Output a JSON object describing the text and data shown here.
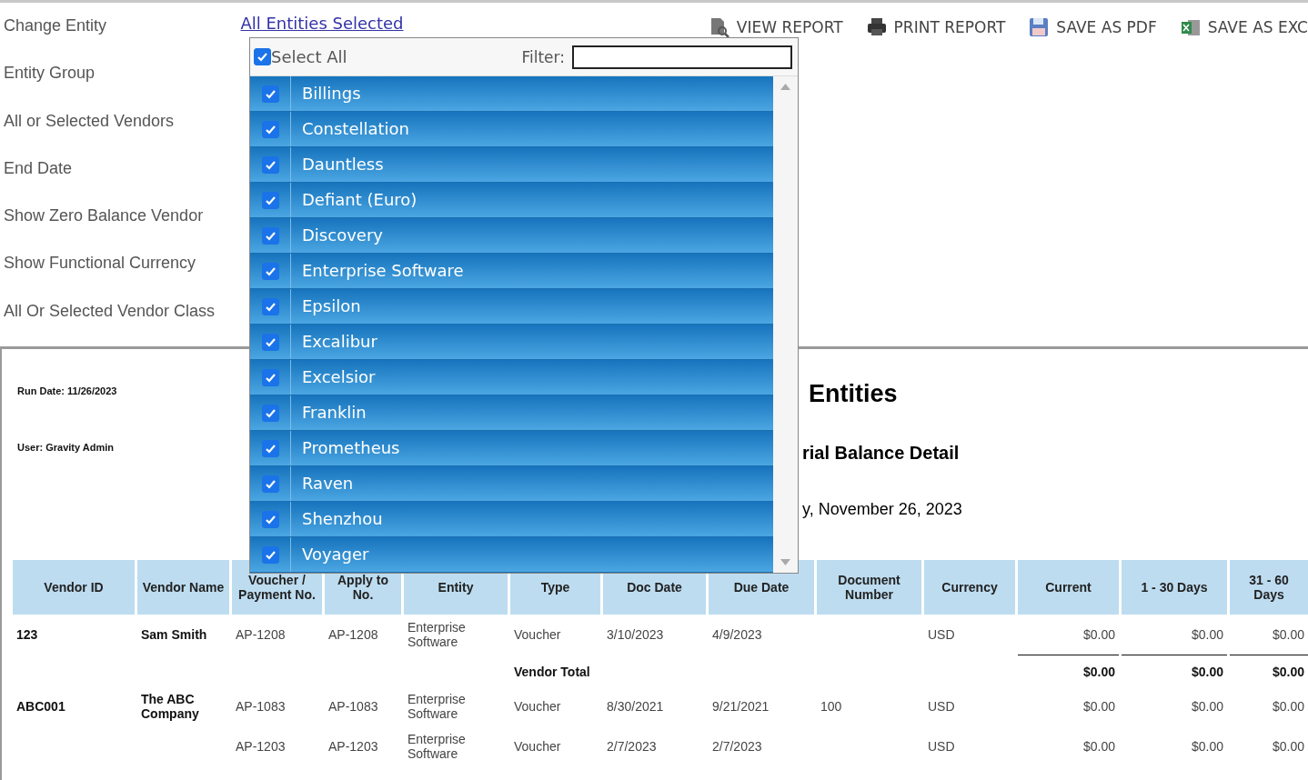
{
  "filters": {
    "labels": [
      "Change Entity",
      "Entity Group",
      "All or Selected Vendors",
      "End Date",
      "Show Zero Balance Vendor",
      "Show Functional Currency",
      "All Or Selected Vendor Class"
    ],
    "entity_link": "All Entities Selected"
  },
  "toolbar": [
    {
      "kind": "view",
      "label": "VIEW REPORT"
    },
    {
      "kind": "print",
      "label": "PRINT REPORT"
    },
    {
      "kind": "pdf",
      "label": "SAVE AS PDF"
    },
    {
      "kind": "excel",
      "label": "SAVE AS EXC"
    }
  ],
  "dropdown": {
    "select_all": {
      "label": "Select All",
      "checked": true
    },
    "filter_label": "Filter:",
    "items": [
      {
        "label": "Billings",
        "checked": true
      },
      {
        "label": "Constellation",
        "checked": true
      },
      {
        "label": "Dauntless",
        "checked": true
      },
      {
        "label": "Defiant (Euro)",
        "checked": true
      },
      {
        "label": "Discovery",
        "checked": true
      },
      {
        "label": "Enterprise Software",
        "checked": true
      },
      {
        "label": "Epsilon",
        "checked": true
      },
      {
        "label": "Excalibur",
        "checked": true
      },
      {
        "label": "Excelsior",
        "checked": true
      },
      {
        "label": "Franklin",
        "checked": true
      },
      {
        "label": "Prometheus",
        "checked": true
      },
      {
        "label": "Raven",
        "checked": true
      },
      {
        "label": "Shenzhou",
        "checked": true
      },
      {
        "label": "Voyager",
        "checked": true
      }
    ]
  },
  "report": {
    "run_date": "Run Date: 11/26/2023",
    "user": "User: Gravity Admin",
    "title": "Entities",
    "subtitle": "rial Balance Detail",
    "date": "y, November 26, 2023",
    "table": {
      "columns": [
        "Vendor ID",
        "Vendor Name",
        "Voucher / Payment No.",
        "Apply to No.",
        "Entity",
        "Type",
        "Doc Date",
        "Due Date",
        "Document Number",
        "Currency",
        "Current",
        "1 - 30 Days",
        "31 - 60 Days"
      ],
      "rows": [
        {
          "kind": "line",
          "cells": [
            "123",
            "Sam Smith",
            "AP-1208",
            "AP-1208",
            "Enterprise Software",
            "Voucher",
            "3/10/2023",
            "4/9/2023",
            null,
            "USD",
            "$0.00",
            "$0.00",
            "$0.00"
          ]
        },
        {
          "kind": "total",
          "cells": [
            null,
            null,
            null,
            null,
            null,
            "Vendor Total",
            null,
            null,
            null,
            null,
            "$0.00",
            "$0.00",
            "$0.00"
          ]
        },
        {
          "kind": "line",
          "cells": [
            "ABC001",
            "The ABC Company",
            "AP-1083",
            "AP-1083",
            "Enterprise Software",
            "Voucher",
            "8/30/2021",
            "9/21/2021",
            "100",
            "USD",
            "$0.00",
            "$0.00",
            "$0.00"
          ]
        },
        {
          "kind": "line",
          "cells": [
            null,
            null,
            "AP-1203",
            "AP-1203",
            "Enterprise Software",
            "Voucher",
            "2/7/2023",
            "2/7/2023",
            null,
            "USD",
            "$0.00",
            "$0.00",
            "$0.00"
          ]
        }
      ]
    }
  }
}
